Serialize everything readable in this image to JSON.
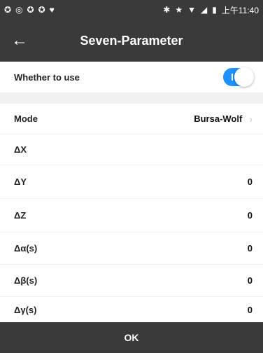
{
  "status_bar": {
    "left_icons": [
      "notification-icon-1",
      "notification-icon-2",
      "notification-icon-3",
      "notification-icon-4",
      "notification-icon-5"
    ],
    "right_icons": [
      "bluetooth-icon",
      "star-icon",
      "wifi-icon",
      "signal-icon",
      "battery-icon"
    ],
    "time": "上午11:40"
  },
  "app_bar": {
    "back_icon": "arrow-left-icon",
    "title": "Seven-Parameter"
  },
  "settings": {
    "use": {
      "label": "Whether to use",
      "enabled": true
    },
    "mode": {
      "label": "Mode",
      "value": "Bursa-Wolf"
    },
    "params": [
      {
        "label": "ΔX",
        "value": ""
      },
      {
        "label": "ΔY",
        "value": "0"
      },
      {
        "label": "ΔZ",
        "value": "0"
      },
      {
        "label": "Δα(s)",
        "value": "0"
      },
      {
        "label": "Δβ(s)",
        "value": "0"
      },
      {
        "label": "Δγ(s)",
        "value": "0"
      }
    ]
  },
  "footer": {
    "ok_label": "OK"
  },
  "colors": {
    "bar_bg": "#3a3a3a",
    "toggle_on": "#1e90ff",
    "divider": "#f1f1f1"
  }
}
